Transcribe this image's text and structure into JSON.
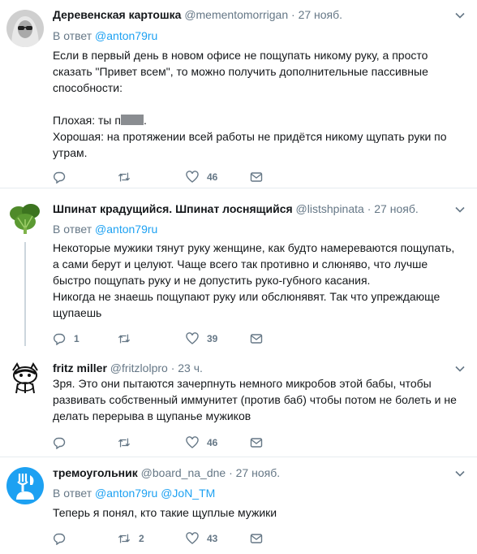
{
  "tweets": [
    {
      "name": "Деревенская картошка",
      "handle": "@mementomorrigan",
      "date": "27 нояб.",
      "reply_prefix": "В ответ",
      "reply_mentions": [
        "@anton79ru"
      ],
      "lines": [
        "Если в первый день в новом офисе не пощупать никому руку, а просто",
        "сказать \"Привет всем\", то можно получить дополнительные пассивные",
        "способности:"
      ],
      "bad_prefix": "Плохая: ты п",
      "bad_suffix": ".",
      "good_lines": [
        "Хорошая: на протяжении всей работы не придётся никому щупать руки по",
        "утрам."
      ],
      "actions": {
        "reply": "",
        "retweet": "",
        "like": "46"
      }
    },
    {
      "name": "Шпинат крадущийся. Шпинат лоснящийся",
      "handle": "@listshpinata",
      "date": "27 нояб.",
      "reply_prefix": "В ответ",
      "reply_mentions": [
        "@anton79ru"
      ],
      "lines": [
        "Некоторые мужики тянут руку женщине, как будто намереваются пощупать,",
        "а сами берут и целуют. Чаще всего так противно и слюняво, что лучше",
        "быстро пощупать руку и не допустить руко-губного касания.",
        "Никогда не знаешь пощупают руку или обслюнявят. Так что упреждающе",
        "щупаешь"
      ],
      "actions": {
        "reply": "1",
        "retweet": "",
        "like": "39"
      }
    },
    {
      "name": "fritz miller",
      "handle": "@fritzlolpro",
      "date": "23 ч.",
      "lines": [
        "Зря. Это они пытаются зачерпнуть немного микробов этой бабы, чтобы",
        "развивать собственный иммунитет (против баб) чтобы потом не болеть и не",
        "делать перерыва в щупанье мужиков"
      ],
      "actions": {
        "reply": "",
        "retweet": "",
        "like": "46"
      }
    },
    {
      "name": "тремоугольник",
      "handle": "@board_na_dne",
      "date": "27 нояб.",
      "reply_prefix": "В ответ",
      "reply_mentions": [
        "@anton79ru",
        "@JoN_TM"
      ],
      "lines": [
        "Теперь я понял, кто такие щуплые мужики"
      ],
      "actions": {
        "reply": "",
        "retweet": "2",
        "like": "43"
      }
    }
  ],
  "separator_dot": "·",
  "colors": {
    "link": "#1da1f2",
    "muted": "#657786",
    "text": "#14171a",
    "border": "#e6ecf0"
  }
}
